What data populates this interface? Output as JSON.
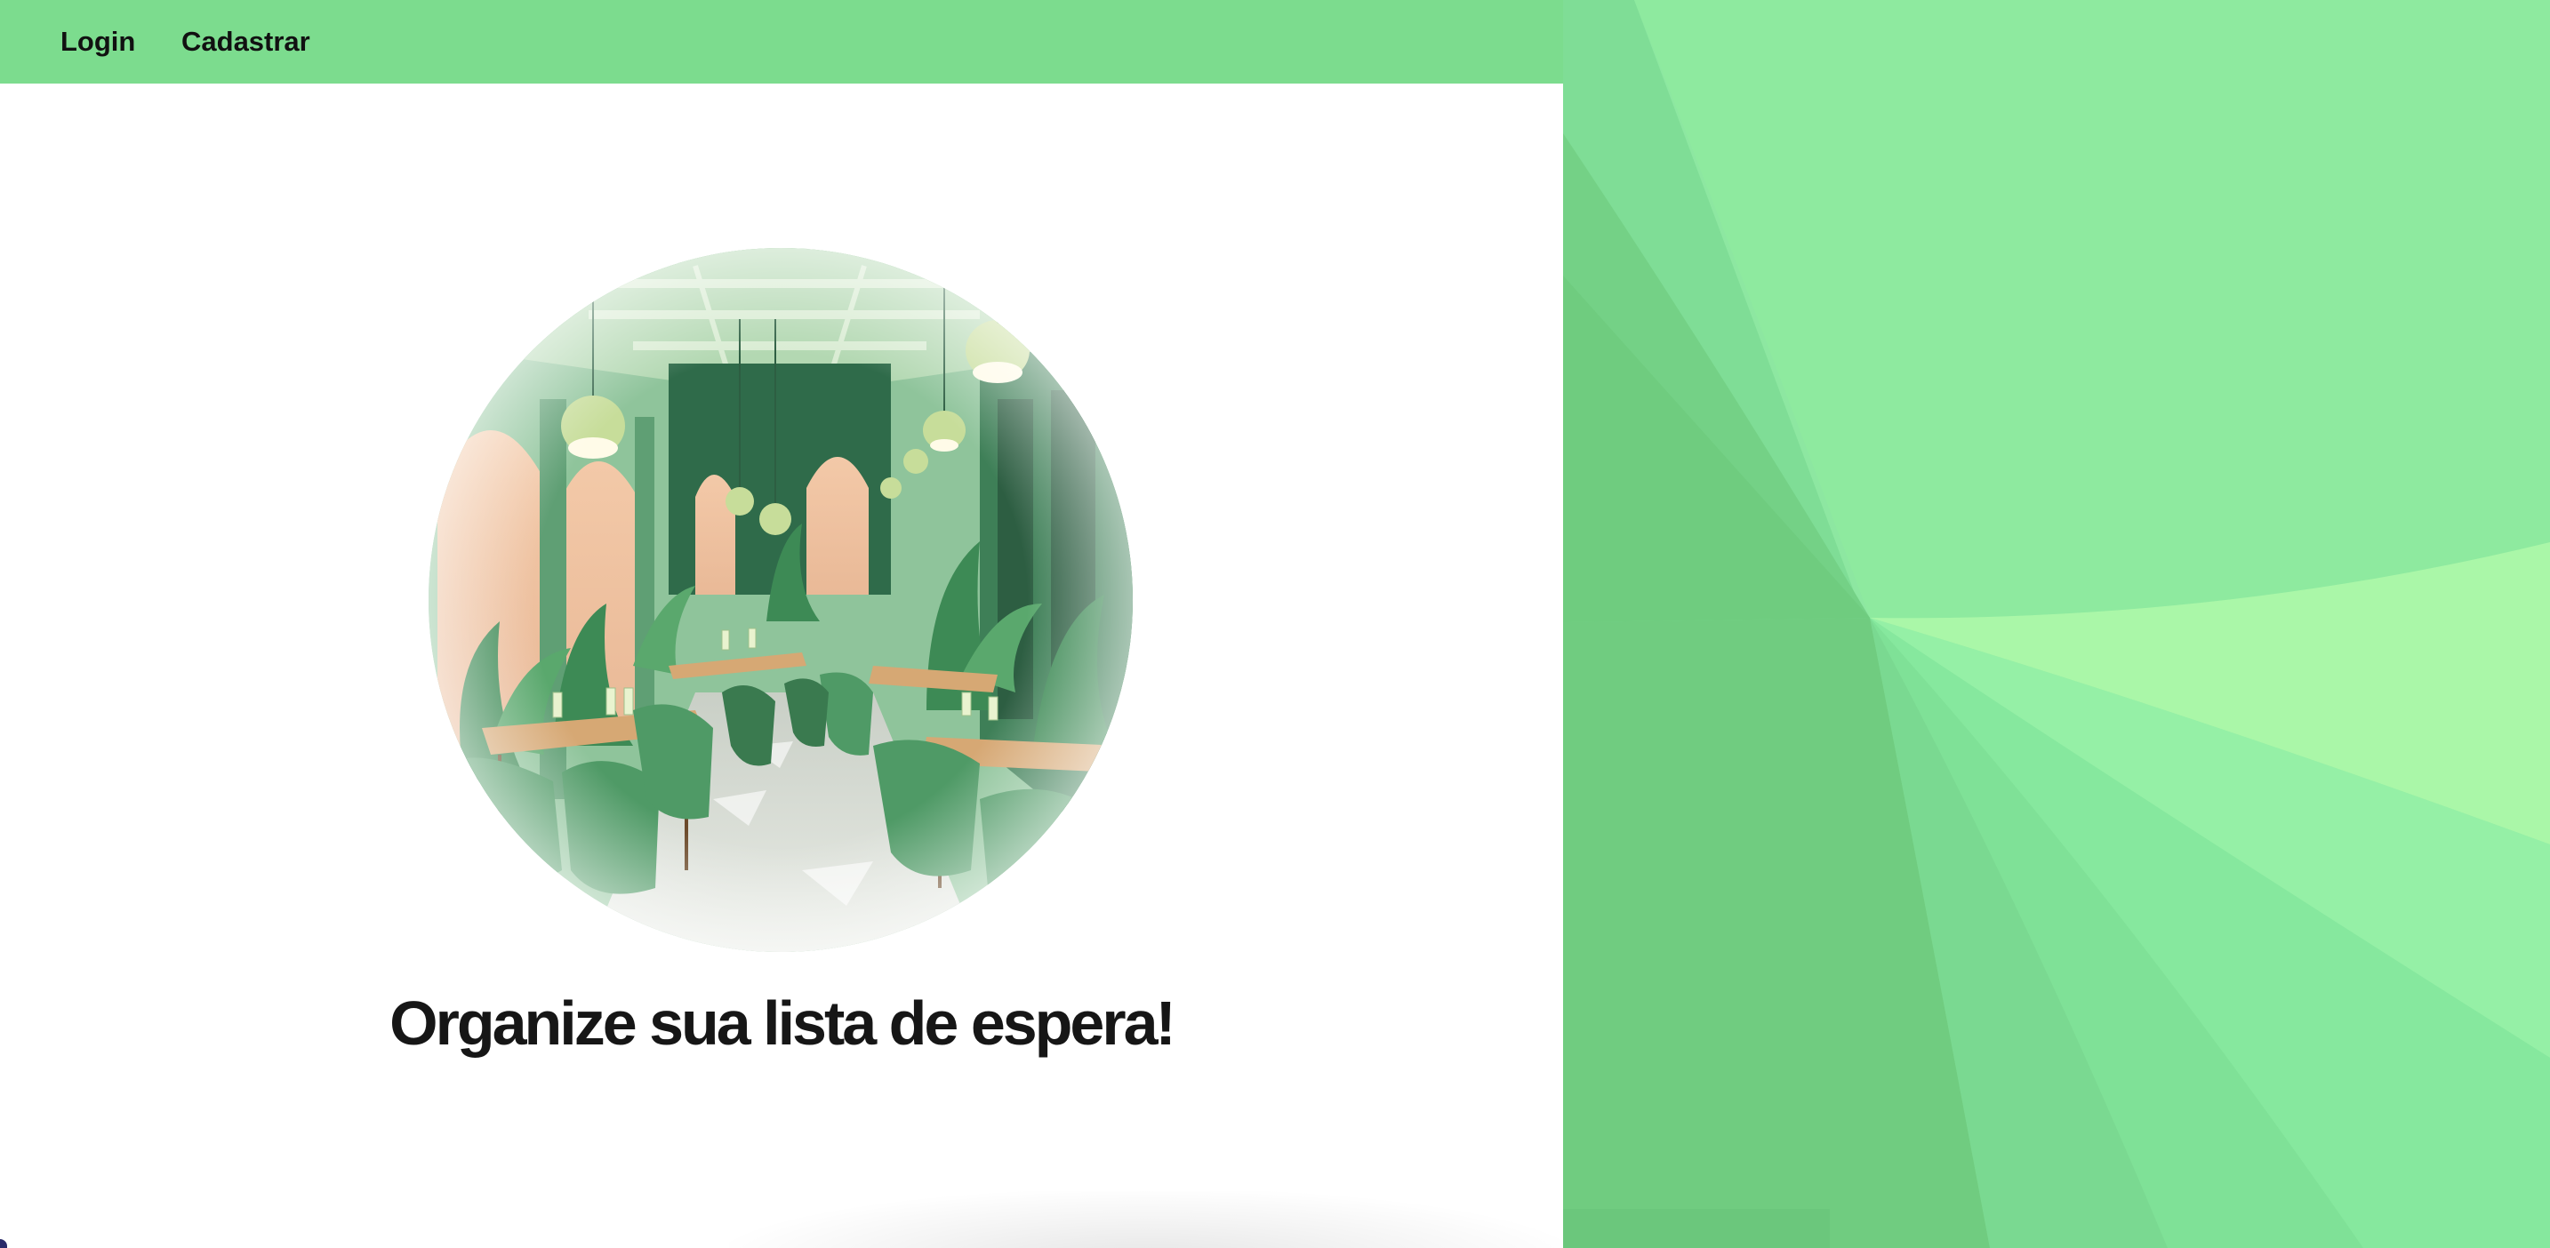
{
  "nav": {
    "login_label": "Login",
    "register_label": "Cadastrar"
  },
  "hero": {
    "title": "Organize sua lista de espera!",
    "image_icon": "restaurant-illustration"
  },
  "colors": {
    "navbar": "#7cdc8e",
    "accent_green": "#6fcf7f",
    "light_green": "#aaf7a8",
    "title_text": "#161616"
  }
}
